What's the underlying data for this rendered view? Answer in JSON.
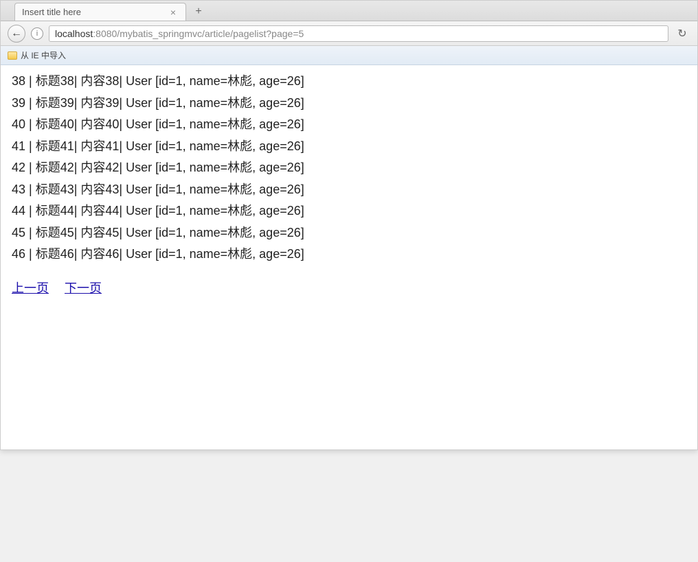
{
  "tab": {
    "title": "Insert title here"
  },
  "url": {
    "host": "localhost",
    "port_path": ":8080/mybatis_springmvc/article/pagelist?page=5"
  },
  "bookmarks": {
    "ie_import": "从 IE 中导入"
  },
  "rows": [
    "38 | 标题38| 内容38| User [id=1, name=林彪, age=26]",
    "39 | 标题39| 内容39| User [id=1, name=林彪, age=26]",
    "40 | 标题40| 内容40| User [id=1, name=林彪, age=26]",
    "41 | 标题41| 内容41| User [id=1, name=林彪, age=26]",
    "42 | 标题42| 内容42| User [id=1, name=林彪, age=26]",
    "43 | 标题43| 内容43| User [id=1, name=林彪, age=26]",
    "44 | 标题44| 内容44| User [id=1, name=林彪, age=26]",
    "45 | 标题45| 内容45| User [id=1, name=林彪, age=26]",
    "46 | 标题46| 内容46| User [id=1, name=林彪, age=26]"
  ],
  "pagination": {
    "prev": "上一页",
    "next": "下一页"
  }
}
